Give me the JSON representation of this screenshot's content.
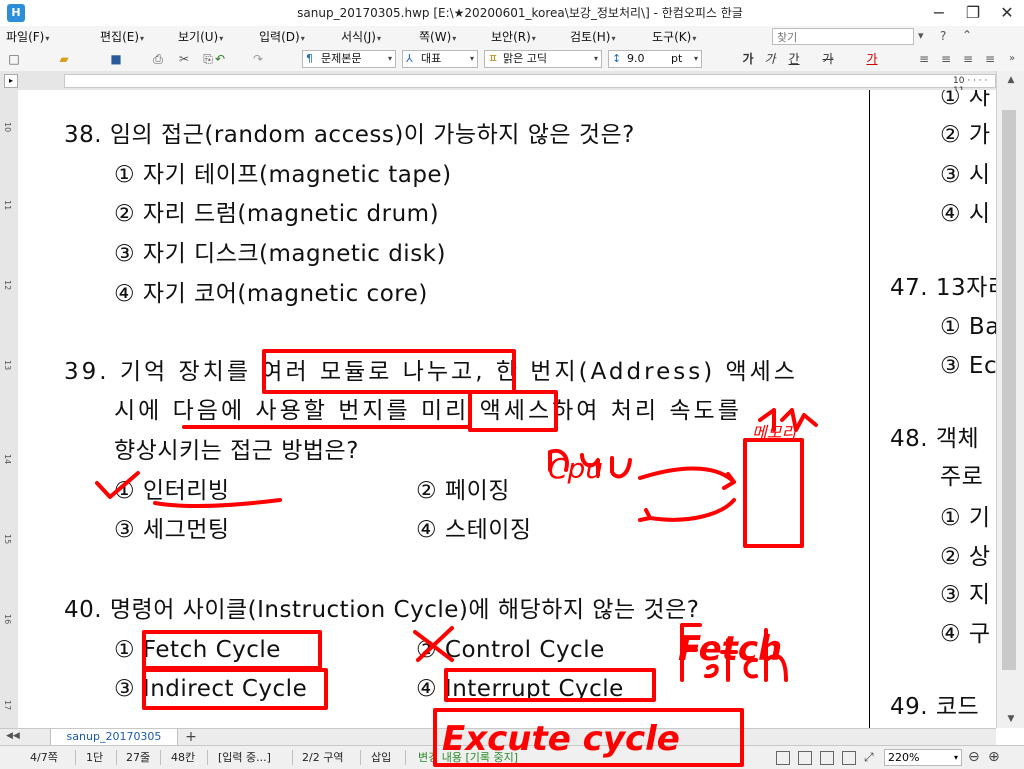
{
  "window": {
    "title": "sanup_20170305.hwp [E:\\★20200601_korea\\보강_정보처리\\] - 한컴오피스 한글",
    "app_icon": "hwp-app-icon",
    "controls": [
      "−",
      "❐",
      "✕"
    ]
  },
  "menu": {
    "items": [
      "파일(F)",
      "편집(E)",
      "보기(U)",
      "입력(D)",
      "서식(J)",
      "쪽(W)",
      "보안(R)",
      "검토(H)",
      "도구(K)"
    ],
    "search_placeholder": "찾기"
  },
  "toolbar": {
    "style": "문제본문",
    "lang_font_target": "대표",
    "font": "맑은 고딕",
    "size": "9.0",
    "unit": "pt",
    "format_buttons": [
      "가",
      "가",
      "간",
      "가",
      "가"
    ]
  },
  "ruler": {
    "right_number": "10 · · · · 11"
  },
  "vruler": {
    "numbers": [
      "10",
      "11",
      "12",
      "13",
      "14",
      "15",
      "16",
      "17"
    ]
  },
  "document": {
    "left": {
      "q38": {
        "stem": "38. 임의 접근(random access)이 가능하지 않은 것은?",
        "options": [
          "① 자기 테이프(magnetic tape)",
          "② 자리 드럼(magnetic drum)",
          "③ 자기 디스크(magnetic disk)",
          "④ 자기 코어(magnetic core)"
        ]
      },
      "q39": {
        "stem_lines": [
          "39. 기억 장치를 여러 모듈로 나누고, 한 번지(Address) 액세스",
          "시에 다음에 사용할 번지를 미리 액세스하여 처리 속도를",
          "향상시키는 접근 방법은?"
        ],
        "options": [
          "① 인터리빙",
          "② 페이징",
          "③ 세그먼팅",
          "④ 스테이징"
        ]
      },
      "q40": {
        "stem": "40. 명령어 사이클(Instruction Cycle)에 해당하지 않는 것은?",
        "options": [
          "① Fetch Cycle",
          "② Control Cycle",
          "③ Indirect Cycle",
          "④ Interrupt Cycle"
        ]
      }
    },
    "right": {
      "lines": [
        "① 자",
        "② 가",
        "③ 시",
        "④ 시",
        "47. 13자리",
        "① Ba",
        "③ Ec",
        "48. 객체",
        "주로",
        "① 기",
        "② 상",
        "③ 지",
        "④ 구",
        "49. 코드"
      ]
    }
  },
  "annotations": {
    "cpu": "Cpu",
    "memory": "메모리",
    "fetch": "Fetch",
    "execute": "Excute cycle",
    "check": "✓",
    "cross": "✕",
    "pen_color": "#ff0000"
  },
  "tabbar": {
    "doc_tab": "sanup_20170305",
    "add": "+"
  },
  "status": {
    "page": "4/7쪽",
    "column": "1단",
    "line": "27줄",
    "char": "48칸",
    "input": "[입력 중...]",
    "section": "2/2 구역",
    "mode": "삽입",
    "track": "변경 내용 [기록 중지]",
    "zoom": "220%"
  }
}
